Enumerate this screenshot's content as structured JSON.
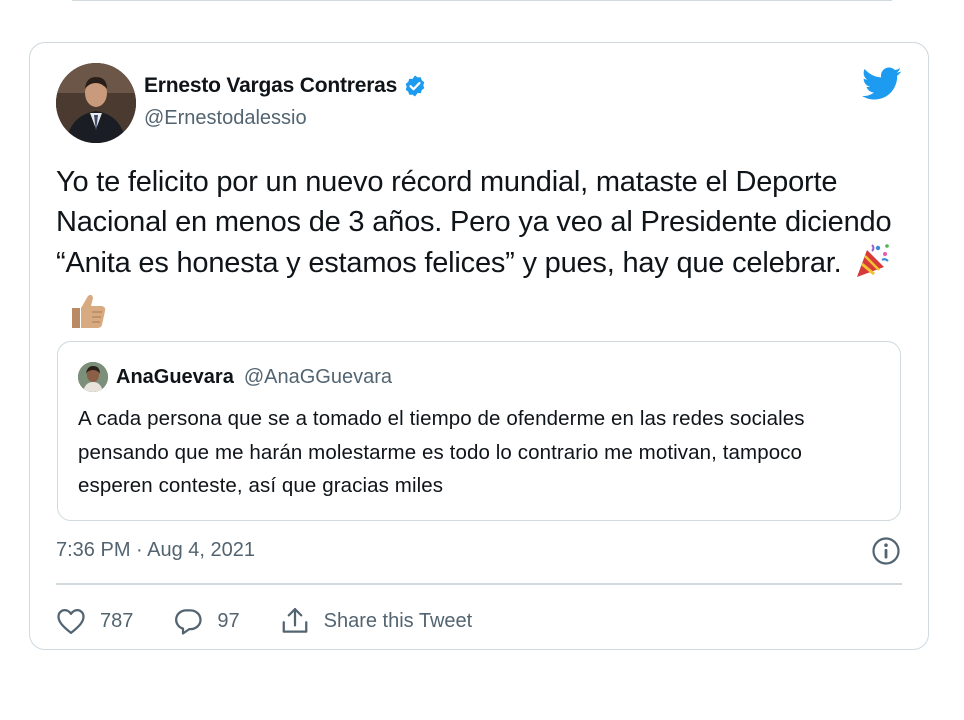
{
  "tweet": {
    "author_name": "Ernesto Vargas Contreras",
    "author_handle": "@Ernestodalessio",
    "verified": true,
    "text": "Yo te felicito por un nuevo récord mundial, mataste el Deporte Nacional en menos de 3 años. Pero ya veo al Presidente diciendo “Anita es honesta y estamos felices” y pues, hay que celebrar.",
    "emojis": [
      "party-popper",
      "thumbs-up"
    ],
    "timestamp": "7:36 PM · Aug 4, 2021",
    "likes": "787",
    "replies": "97",
    "share_label": "Share this Tweet"
  },
  "quoted_tweet": {
    "author_name": "AnaGuevara",
    "author_handle": "@AnaGGuevara",
    "text": "A cada persona que se a tomado el tiempo de ofenderme en las redes sociales pensando que me harán molestarme es todo lo contrario me motivan, tampoco esperen conteste, así que gracias miles"
  },
  "icons": {
    "logo": "twitter-bird-icon",
    "verified": "verified-badge-icon",
    "info": "info-icon",
    "like": "heart-icon",
    "reply": "reply-icon",
    "share": "share-icon"
  },
  "colors": {
    "brand": "#1d9bf0",
    "text": "#0f1419",
    "secondary_text": "#536471",
    "border": "#cfd9de"
  }
}
